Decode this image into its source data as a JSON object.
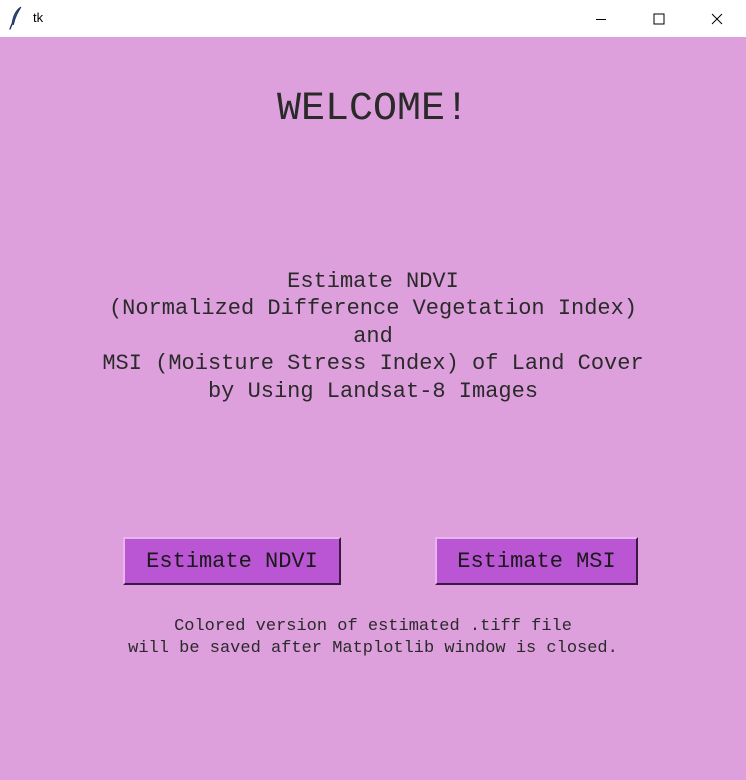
{
  "window": {
    "title": "tk",
    "icon": "feather-icon",
    "controls": [
      "minimize-icon",
      "maximize-icon",
      "close-icon"
    ]
  },
  "main": {
    "heading": "WELCOME!",
    "description_lines": [
      "Estimate NDVI",
      "(Normalized Difference Vegetation Index)",
      "and",
      "MSI (Moisture Stress Index) of Land Cover",
      "by Using Landsat-8 Images"
    ],
    "buttons": {
      "ndvi_label": "Estimate NDVI",
      "msi_label": "Estimate MSI"
    },
    "note_lines": [
      "Colored version of estimated .tiff file",
      "will be saved after Matplotlib window is closed."
    ]
  },
  "colors": {
    "background": "#dda0dd",
    "button": "#ba55d3",
    "text": "#2a2a2a"
  }
}
